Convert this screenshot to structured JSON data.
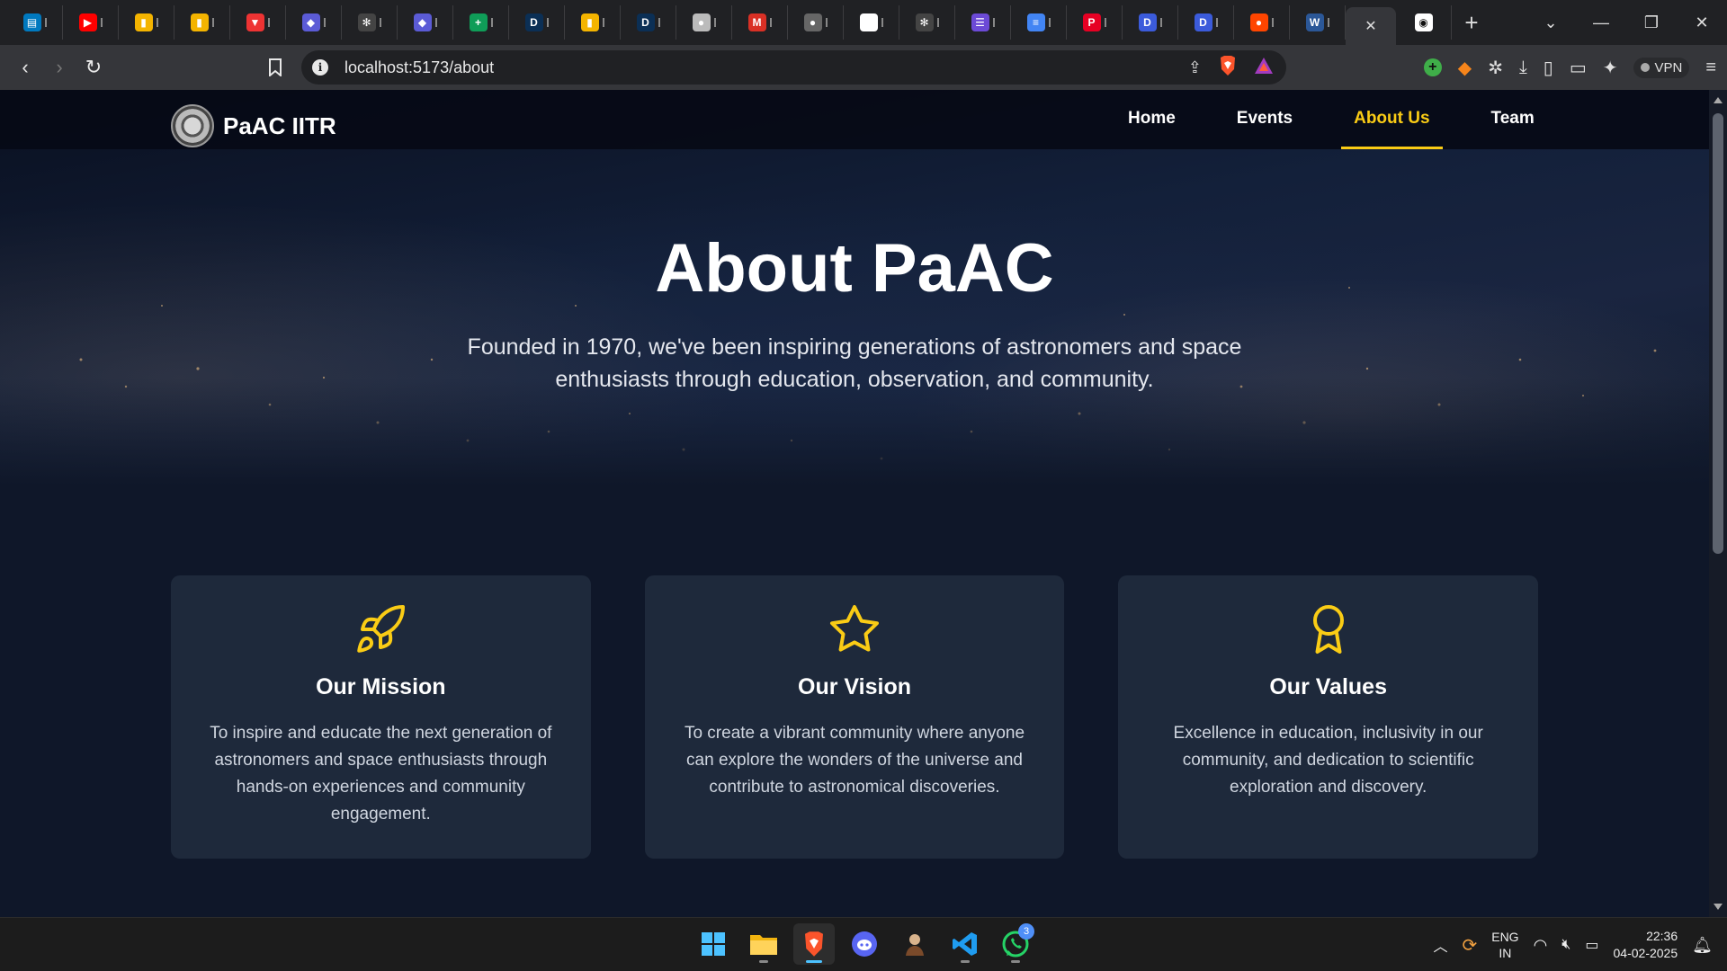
{
  "browser": {
    "url": "localhost:5173/about",
    "vpn_label": "VPN",
    "tabs": [
      {
        "icon": "trello-icon",
        "color": "#0079bf"
      },
      {
        "icon": "youtube-icon",
        "color": "#ff0000"
      },
      {
        "icon": "analytics-icon",
        "color": "#f4b400"
      },
      {
        "icon": "analytics-icon",
        "color": "#f4b400"
      },
      {
        "icon": "vercel-icon",
        "color": "#e33"
      },
      {
        "icon": "app-icon",
        "color": "#5b5bd6"
      },
      {
        "icon": "chatgpt-icon",
        "color": "#444"
      },
      {
        "icon": "app-icon",
        "color": "#5b5bd6"
      },
      {
        "icon": "sheets-icon",
        "color": "#0f9d58"
      },
      {
        "icon": "d-icon",
        "color": "#0b2f55"
      },
      {
        "icon": "analytics-icon",
        "color": "#f4b400"
      },
      {
        "icon": "d-icon",
        "color": "#0b2f55"
      },
      {
        "icon": "circle-icon",
        "color": "#bbb"
      },
      {
        "icon": "gmail-icon",
        "color": "#d93025"
      },
      {
        "icon": "circle-icon",
        "color": "#666"
      },
      {
        "icon": "github-icon",
        "color": "#fff"
      },
      {
        "icon": "chatgpt-icon",
        "color": "#444"
      },
      {
        "icon": "list-icon",
        "color": "#6c4ad6"
      },
      {
        "icon": "docs-icon",
        "color": "#4285f4"
      },
      {
        "icon": "pinterest-icon",
        "color": "#e60023"
      },
      {
        "icon": "d-icon",
        "color": "#3b5bdb"
      },
      {
        "icon": "d-icon",
        "color": "#3b5bdb"
      },
      {
        "icon": "reddit-icon",
        "color": "#ff4500"
      },
      {
        "icon": "w-icon",
        "color": "#2b5797"
      }
    ]
  },
  "site": {
    "brand": "PaAC IITR",
    "nav": [
      {
        "label": "Home",
        "active": false
      },
      {
        "label": "Events",
        "active": false
      },
      {
        "label": "About Us",
        "active": true
      },
      {
        "label": "Team",
        "active": false
      }
    ],
    "hero_title": "About PaAC",
    "hero_subtitle": "Founded in 1970, we've been inspiring generations of astronomers and space enthusiasts through education, observation, and community.",
    "accent_color": "#facc15",
    "cards": [
      {
        "icon": "rocket-icon",
        "title": "Our Mission",
        "text": "To inspire and educate the next generation of astronomers and space enthusiasts through hands-on experiences and community engagement."
      },
      {
        "icon": "star-icon",
        "title": "Our Vision",
        "text": "To create a vibrant community where anyone can explore the wonders of the universe and contribute to astronomical discoveries."
      },
      {
        "icon": "award-icon",
        "title": "Our Values",
        "text": "Excellence in education, inclusivity in our community, and dedication to scientific exploration and discovery."
      }
    ]
  },
  "taskbar": {
    "whatsapp_badge": "3",
    "lang_line1": "ENG",
    "lang_line2": "IN",
    "time": "22:36",
    "date": "04-02-2025"
  }
}
